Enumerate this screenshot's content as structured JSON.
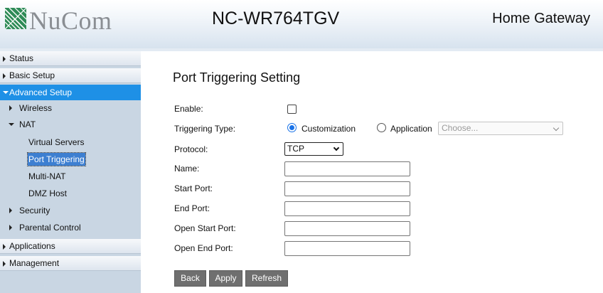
{
  "header": {
    "brand": "NuCom",
    "model": "NC-WR764TGV",
    "product": "Home Gateway"
  },
  "sidebar": {
    "status": "Status",
    "basic_setup": "Basic Setup",
    "advanced_setup": "Advanced Setup",
    "wireless": "Wireless",
    "nat": "NAT",
    "virtual_servers": "Virtual Servers",
    "port_triggering": "Port Triggering",
    "multi_nat": "Multi-NAT",
    "dmz_host": "DMZ Host",
    "security": "Security",
    "parental_control": "Parental Control",
    "applications": "Applications",
    "management": "Management"
  },
  "form": {
    "title": "Port Triggering Setting",
    "enable_label": "Enable:",
    "triggering_type_label": "Triggering Type:",
    "customization_label": "Customization",
    "application_label": "Application",
    "application_placeholder": "Choose...",
    "protocol_label": "Protocol:",
    "protocol_value": "TCP",
    "name_label": "Name:",
    "start_port_label": "Start Port:",
    "end_port_label": "End Port:",
    "open_start_port_label": "Open Start Port:",
    "open_end_port_label": "Open End Port:"
  },
  "buttons": {
    "back": "Back",
    "apply": "Apply",
    "refresh": "Refresh"
  }
}
